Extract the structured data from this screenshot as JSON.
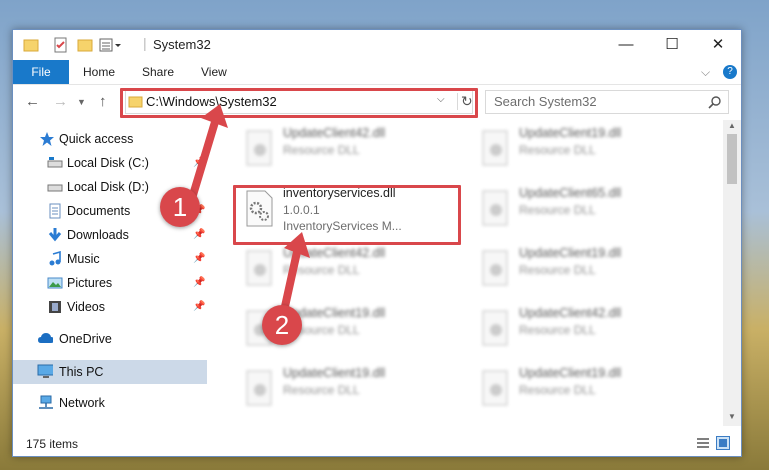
{
  "window": {
    "title": "System32",
    "minimize_glyph": "—",
    "maximize_glyph": "☐",
    "close_glyph": "✕"
  },
  "ribbon": {
    "tabs": [
      "File",
      "Home",
      "Share",
      "View"
    ],
    "expand_glyph": "⌵",
    "help_glyph": "?"
  },
  "nav": {
    "address": "C:\\Windows\\System32",
    "search_placeholder": "Search System32"
  },
  "sidebar": {
    "items": [
      {
        "label": "Quick access",
        "icon": "star-icon"
      },
      {
        "label": "Local Disk (C:)",
        "icon": "drive-icon"
      },
      {
        "label": "Local Disk (D:)",
        "icon": "drive-icon"
      },
      {
        "label": "Documents",
        "icon": "documents-icon"
      },
      {
        "label": "Downloads",
        "icon": "downloads-icon"
      },
      {
        "label": "Music",
        "icon": "music-icon"
      },
      {
        "label": "Pictures",
        "icon": "pictures-icon"
      },
      {
        "label": "Videos",
        "icon": "videos-icon"
      },
      {
        "label": "OneDrive",
        "icon": "cloud-icon"
      },
      {
        "label": "This PC",
        "icon": "computer-icon"
      },
      {
        "label": "Network",
        "icon": "network-icon"
      }
    ]
  },
  "files": {
    "highlighted": {
      "name": "inventoryservices.dll",
      "version": "1.0.0.1",
      "description": "InventoryServices M..."
    },
    "blurred": [
      {
        "name": "UpdateClient42.dll",
        "type": "Resource DLL"
      },
      {
        "name": "UpdateClient19.dll",
        "type": "Resource DLL"
      },
      {
        "name": "UpdateClient65.dll",
        "type": "Resource DLL"
      },
      {
        "name": "UpdateClient42.dll",
        "type": "Resource DLL"
      },
      {
        "name": "UpdateClient19.dll",
        "type": "Resource DLL"
      },
      {
        "name": "UpdateClient19.dll",
        "type": "Resource DLL"
      },
      {
        "name": "UpdateClient42.dll",
        "type": "Resource DLL"
      },
      {
        "name": "UpdateClient19.dll",
        "type": "Resource DLL"
      },
      {
        "name": "UpdateClient19.dll",
        "type": "Resource DLL"
      }
    ]
  },
  "status": {
    "item_count": "175 items"
  },
  "callouts": [
    "1",
    "2"
  ],
  "colors": {
    "accent": "#1979ca",
    "highlight_red": "#d9474b",
    "selected_bg": "#ccd9e8"
  }
}
